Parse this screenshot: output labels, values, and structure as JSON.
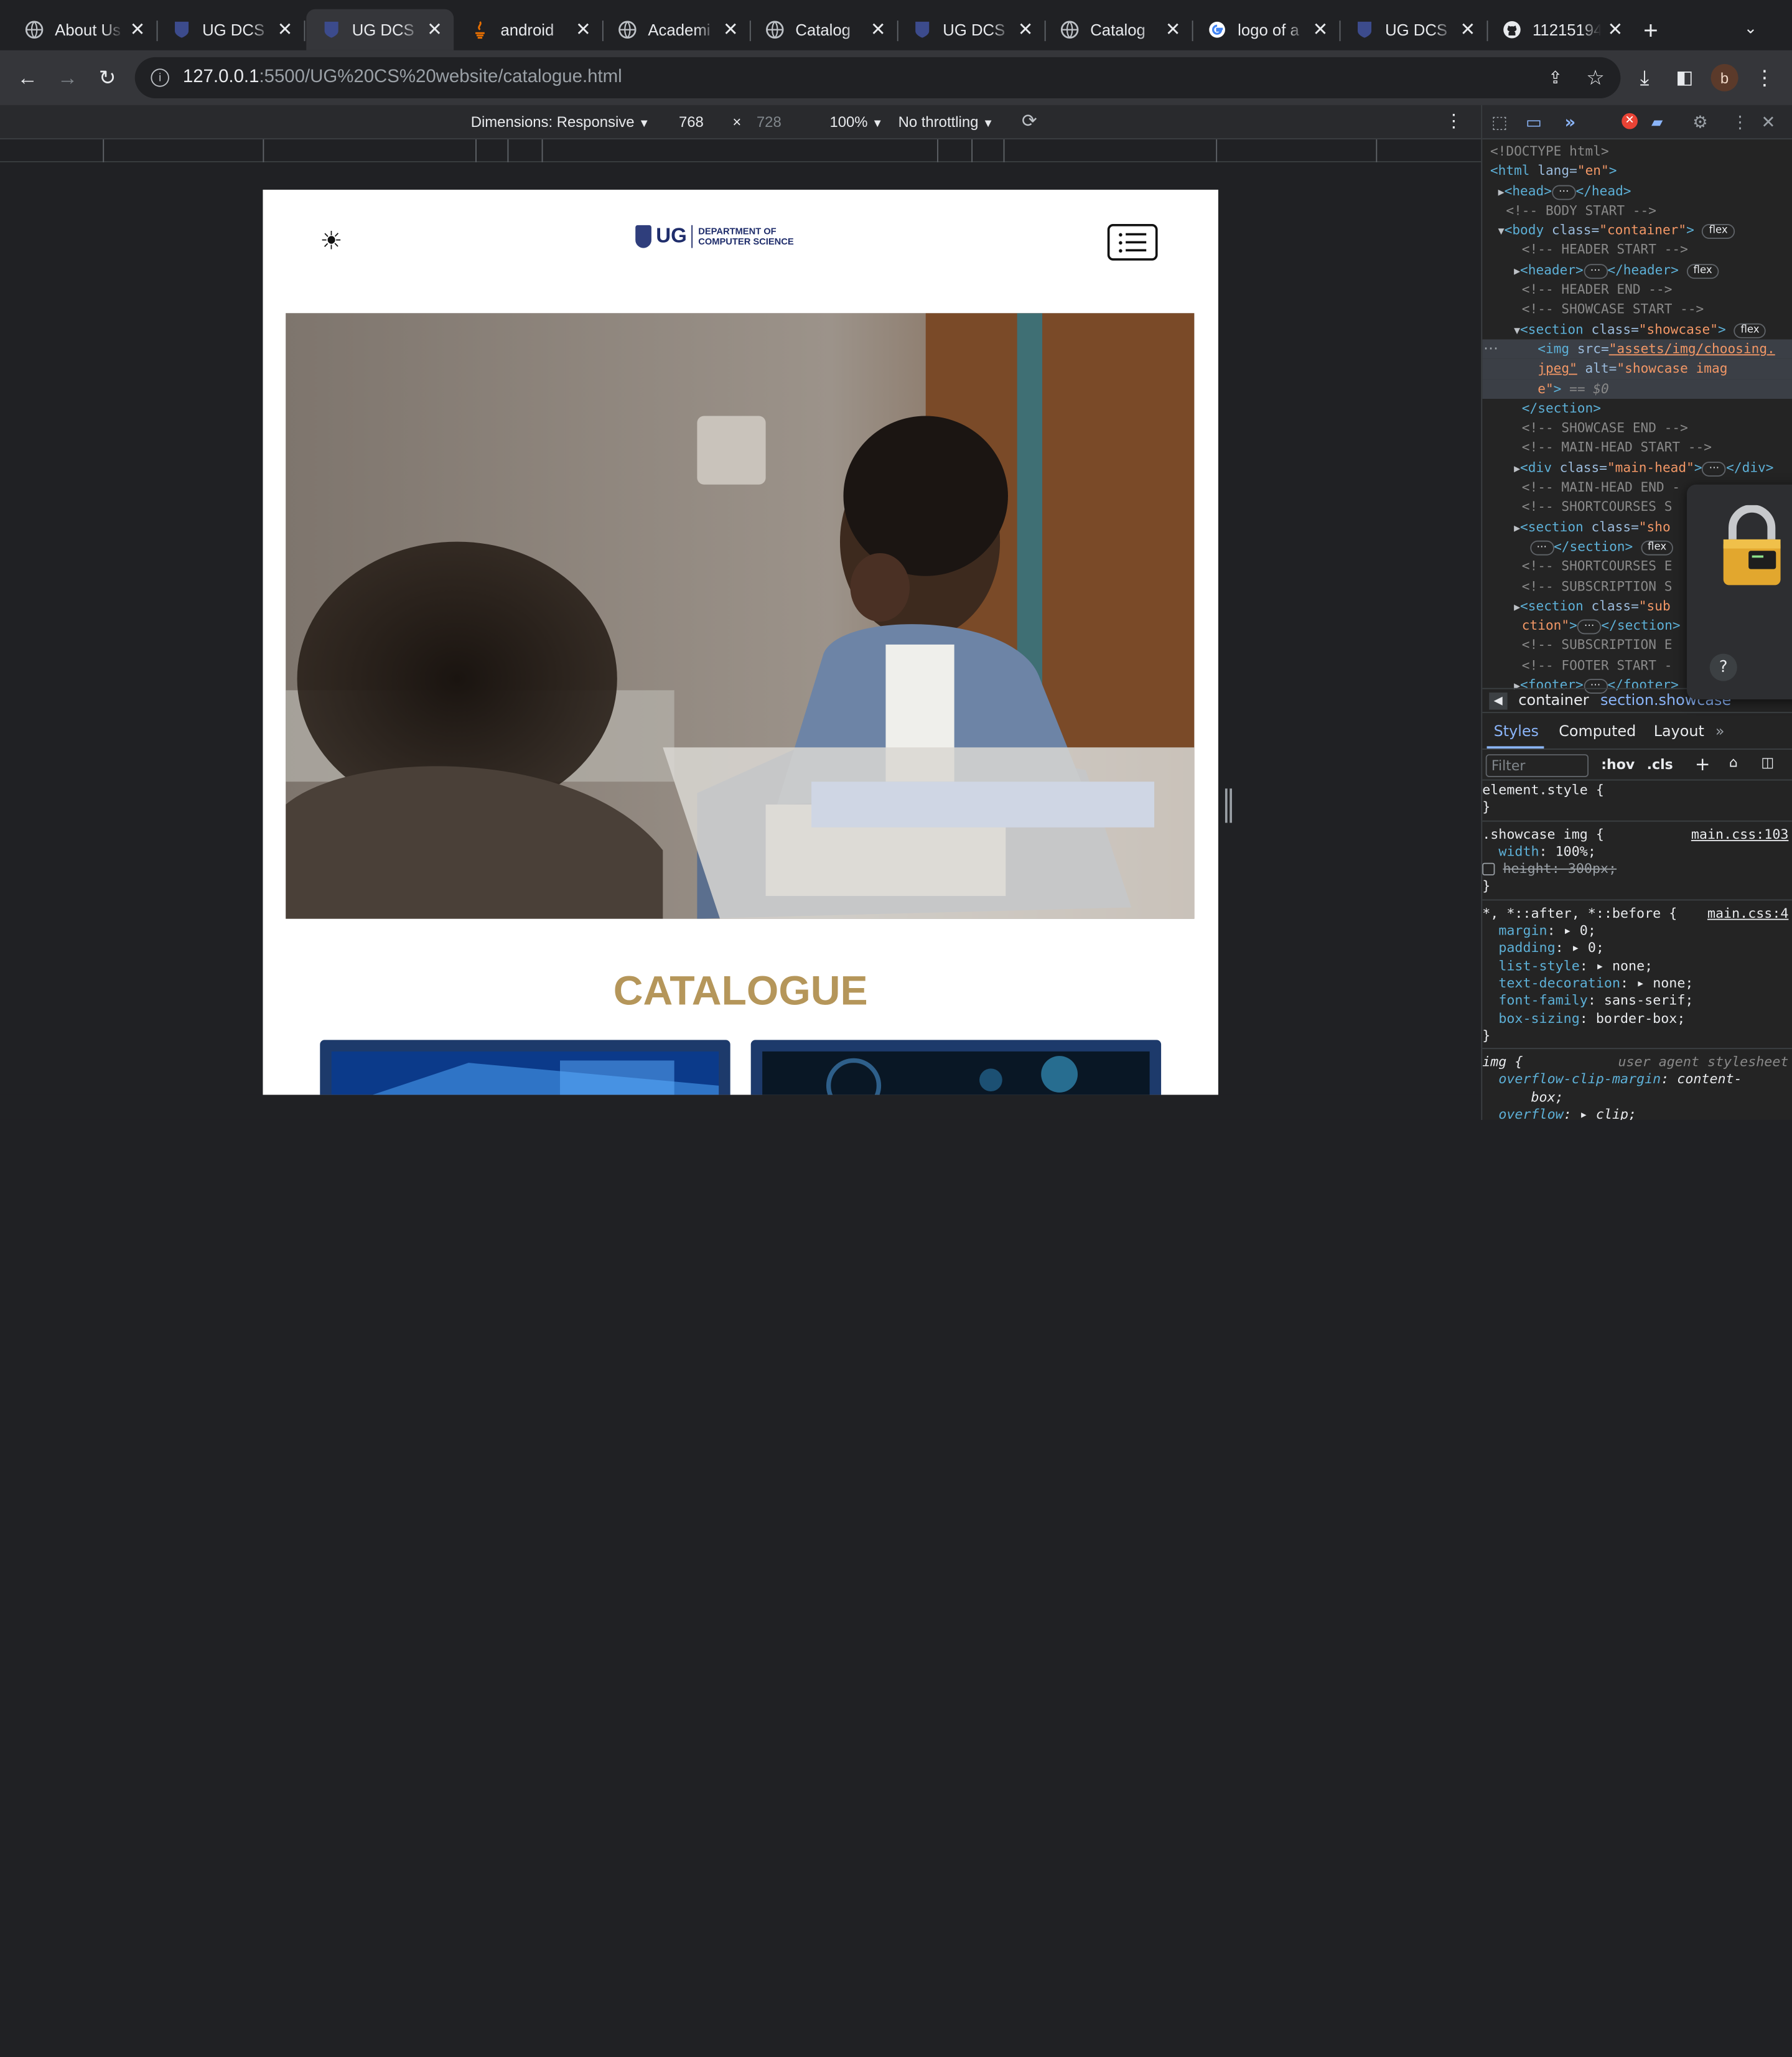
{
  "tabs": [
    {
      "title": "About Us",
      "favicon": "globe-icon"
    },
    {
      "title": "UG DCS",
      "favicon": "ug-crest-icon"
    },
    {
      "title": "UG DCS",
      "favicon": "ug-crest-icon",
      "active": true
    },
    {
      "title": "android",
      "favicon": "java-icon"
    },
    {
      "title": "Academi",
      "favicon": "globe-icon"
    },
    {
      "title": "Catalog",
      "favicon": "globe-icon"
    },
    {
      "title": "UG DCS",
      "favicon": "ug-crest-icon"
    },
    {
      "title": "Catalog",
      "favicon": "globe-icon"
    },
    {
      "title": "logo of a",
      "favicon": "google-icon"
    },
    {
      "title": "UG DCS",
      "favicon": "ug-crest-icon"
    },
    {
      "title": "11215194",
      "favicon": "github-icon"
    }
  ],
  "toolbar": {
    "url_host": "127.0.0.1",
    "url_path": ":5500/UG%20CS%20website/catalogue.html",
    "profile_initial": "b"
  },
  "device_toolbar": {
    "dimensions_label": "Dimensions: Responsive",
    "width": "768",
    "times": "×",
    "height": "728",
    "zoom": "100%",
    "throttle": "No throttling"
  },
  "site": {
    "theme_icon": "☀",
    "logo_text": "UG",
    "dept_line1": "DEPARTMENT OF",
    "dept_line2": "COMPUTER SCIENCE",
    "showcase_alt": "showcase image",
    "heading": "CATALOGUE"
  },
  "devtools": {
    "dom": {
      "doctype": "<!DOCTYPE html>",
      "html_open": "<html",
      "lang_attr": " lang=",
      "lang_val": "\"en\"",
      "gt": ">",
      "head": "<head>",
      "head_close": "</head>",
      "c_body_start": "<!-- BODY START -->",
      "body_open": "<body",
      "class_attr": " class=",
      "body_class": "\"container\"",
      "flex": "flex",
      "c_header_start": "<!-- HEADER START -->",
      "header": "<header>",
      "header_close": "</header>",
      "c_header_end": "<!-- HEADER END -->",
      "c_showcase_start": "<!-- SHOWCASE START -->",
      "section_open": "<section",
      "showcase_class": "\"showcase\"",
      "img_open": "<img",
      "src_attr": " src=",
      "src_val1": "\"assets/img/choosing.",
      "src_val2": "jpeg\"",
      "alt_attr": " alt=",
      "alt_val1": "\"showcase imag",
      "alt_val2": "e\"",
      "eq0": " == $0",
      "section_close": "</section>",
      "c_showcase_end": "<!-- SHOWCASE END -->",
      "c_mainhead_start": "<!-- MAIN-HEAD START -->",
      "div_open": "<div",
      "mainhead_class": "\"main-head\"",
      "div_close": "</div>",
      "c_mainhead_end": "<!-- MAIN-HEAD END -",
      "c_shortcourses_s": "<!-- SHORTCOURSES S",
      "short_class": "\"sho",
      "c_shortcourses_e": "<!-- SHORTCOURSES E",
      "c_subscription_s": "<!-- SUBSCRIPTION S",
      "sub_class": "\"sub",
      "sub_class2": "ction\"",
      "c_subscription_e": "<!-- SUBSCRIPTION E",
      "c_footer_start": "<!-- FOOTER START -",
      "footer": "<footer>",
      "footer_close": "</footer>"
    },
    "breadcrumb": [
      "container",
      "section.showcase"
    ],
    "panel_tabs": [
      "Styles",
      "Computed",
      "Layout"
    ],
    "filter_placeholder": "Filter",
    "hov": ":hov",
    "cls": ".cls",
    "rules": {
      "element_style": "element.style {",
      "close": "}",
      "showcase_sel": ".showcase img {",
      "showcase_src": "main.css:103",
      "width_prop": "width",
      "width_val": ": 100%;",
      "height_decl": "height: 300px;",
      "universal_sel": "*, *::after, *::before {",
      "universal_src": "main.css:4",
      "margin_prop": "margin",
      "margin_val": ": ▸ 0;",
      "padding_prop": "padding",
      "padding_val": ": ▸ 0;",
      "liststyle_prop": "list-style",
      "liststyle_val": ": ▸ none;",
      "textdec_prop": "text-decoration",
      "textdec_val": ": ▸ none;",
      "font_prop": "font-family",
      "font_val": ": sans-serif;",
      "boxsizing_prop": "box-sizing",
      "boxsizing_val": ": border-box;",
      "img_sel": "img {",
      "ua_label": "user agent stylesheet",
      "ocm_prop": "overflow-clip-margin",
      "ocm_val": ": content-",
      "ocm_val2": "box;",
      "overflow_prop": "overflow",
      "overflow_val": ": ▸ clip;"
    }
  },
  "colors": {
    "accent_gold": "#b5965a",
    "ug_navy": "#1f2d6b",
    "devtools_link": "#8ab4f8"
  }
}
